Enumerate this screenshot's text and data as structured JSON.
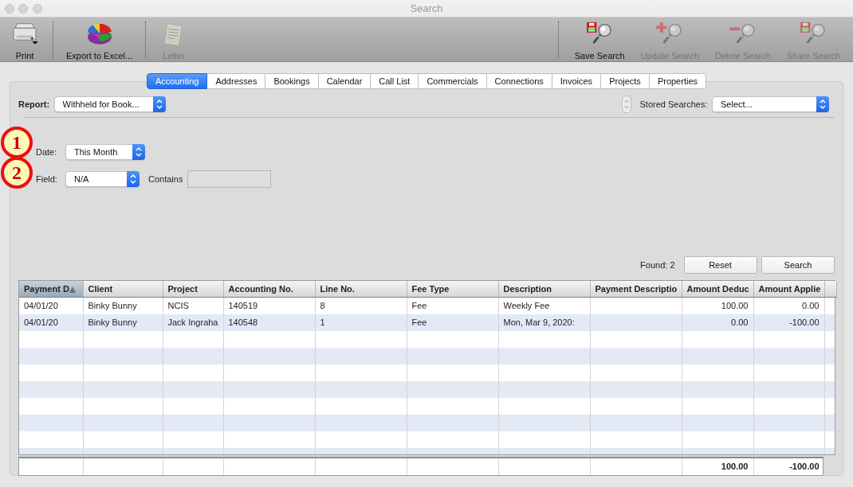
{
  "window": {
    "title": "Search"
  },
  "toolbar": {
    "left": [
      {
        "label": "Print",
        "kind": "printer",
        "disabled": false
      },
      {
        "label": "Export to Excel...",
        "kind": "chart",
        "disabled": false
      },
      {
        "label": "Letter",
        "kind": "letter",
        "disabled": true
      }
    ],
    "right": [
      {
        "label": "Save Search",
        "kind": "save",
        "disabled": false
      },
      {
        "label": "Update Search",
        "kind": "add",
        "disabled": true
      },
      {
        "label": "Delete Search",
        "kind": "remove",
        "disabled": true
      },
      {
        "label": "Share Search",
        "kind": "save",
        "disabled": true
      }
    ]
  },
  "tabs": [
    {
      "label": "Accounting",
      "selected": true
    },
    {
      "label": "Addresses",
      "selected": false
    },
    {
      "label": "Bookings",
      "selected": false
    },
    {
      "label": "Calendar",
      "selected": false
    },
    {
      "label": "Call List",
      "selected": false
    },
    {
      "label": "Commercials",
      "selected": false
    },
    {
      "label": "Connections",
      "selected": false
    },
    {
      "label": "Invoices",
      "selected": false
    },
    {
      "label": "Projects",
      "selected": false
    },
    {
      "label": "Properties",
      "selected": false
    }
  ],
  "report": {
    "label": "Report:",
    "value": "Withheld for Book..."
  },
  "stored_searches": {
    "label": "Stored Searches:",
    "value": "Select..."
  },
  "criteria": [
    {
      "callout": "1",
      "label": "Date:",
      "value": "This Month"
    },
    {
      "callout": "2",
      "label": "Field:",
      "value": "N/A",
      "contains_label": "Contains",
      "contains_disabled": true
    }
  ],
  "found": "Found: 2",
  "buttons": [
    "Reset",
    "Search"
  ],
  "table": {
    "columns": [
      {
        "label": "Payment D",
        "kind": "text",
        "sorted": true
      },
      {
        "label": "Client",
        "kind": "text",
        "sorted": false
      },
      {
        "label": "Project",
        "kind": "text",
        "sorted": false
      },
      {
        "label": "Accounting No.",
        "kind": "text",
        "sorted": false
      },
      {
        "label": "Line No.",
        "kind": "text",
        "sorted": false
      },
      {
        "label": "Fee Type",
        "kind": "text",
        "sorted": false
      },
      {
        "label": "Description",
        "kind": "text",
        "sorted": false
      },
      {
        "label": "Payment Descriptio",
        "kind": "text",
        "sorted": false
      },
      {
        "label": "Amount Deduc",
        "kind": "amount",
        "sorted": false
      },
      {
        "label": "Amount Applie",
        "kind": "amount",
        "sorted": false
      }
    ],
    "rows": [
      [
        "04/01/20",
        "Binky Bunny",
        "NCIS",
        "140519",
        "8",
        "Fee",
        "Weekly Fee",
        null,
        "100.00",
        "0.00"
      ],
      [
        "04/01/20",
        "Binky Bunny",
        "Jack Ingraha",
        "140548",
        "1",
        "Fee",
        "Mon, Mar 9, 2020:",
        null,
        "0.00",
        "-100.00"
      ]
    ],
    "totals": [
      "100.00",
      "-100.00"
    ]
  }
}
